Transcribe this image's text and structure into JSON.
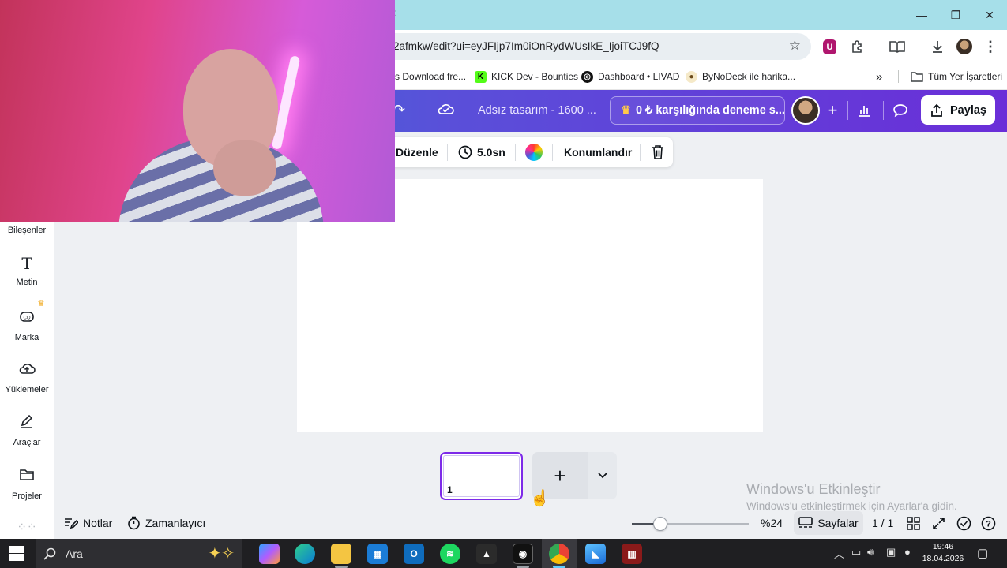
{
  "browser": {
    "url": "2afmkw/edit?ui=eyJFIjp7Im0iOnRydWUsIkE_IjoiTCJ9fQ",
    "bookmarks": [
      {
        "label": "s Download fre..."
      },
      {
        "label": "KICK Dev - Bounties",
        "fav": "K"
      },
      {
        "label": "Dashboard • LIVAD"
      },
      {
        "label": "ByNoDeck ile harika..."
      }
    ],
    "all_bookmarks": "Tüm Yer İşaretleri",
    "ext_badge": "U"
  },
  "canva_header": {
    "doc_title": "Adsız tasarım - 1600 ...",
    "trial_button": "0 ₺ karşılığında deneme s...",
    "share_button": "Paylaş"
  },
  "toolbar": {
    "edit": "Düzenle",
    "duration": "5.0sn",
    "position": "Konumlandır"
  },
  "sidebar": {
    "items": [
      {
        "label": "Bileşenler"
      },
      {
        "label": "Metin"
      },
      {
        "label": "Marka"
      },
      {
        "label": "Yüklemeler"
      },
      {
        "label": "Araçlar"
      },
      {
        "label": "Projeler"
      }
    ]
  },
  "pages": {
    "thumb_number": "1"
  },
  "footer": {
    "notes": "Notlar",
    "timer": "Zamanlayıcı",
    "zoom": "%24",
    "zoom_fraction": 0.24,
    "pages_button": "Sayfalar",
    "page_count": "1 / 1"
  },
  "windows_watermark": {
    "title": "Windows'u Etkinleştir",
    "subtitle": "Windows'u etkinleştirmek için Ayarlar'a gidin."
  },
  "taskbar": {
    "search_placeholder": "Ara",
    "time": "19:46",
    "date": "18.04.2026"
  },
  "colors": {
    "header_start": "#2f7fd6",
    "header_end": "#6a2ed8",
    "selection": "#7d2ae8",
    "titlebar": "#a6dfe9"
  },
  "icons": [
    "star-icon",
    "extensions-icon",
    "reading-list-icon",
    "download-icon",
    "redo-icon",
    "cloud-sync-icon",
    "crown-icon",
    "plus-icon",
    "analytics-icon",
    "comment-icon",
    "share-icon",
    "clock-icon",
    "color-wheel-icon",
    "trash-icon",
    "text-icon",
    "brand-icon",
    "upload-icon",
    "tools-icon",
    "folder-icon",
    "notes-icon",
    "timer-icon",
    "grid-view-icon",
    "fullscreen-icon",
    "check-icon",
    "help-icon",
    "search-icon",
    "windows-start-icon"
  ]
}
